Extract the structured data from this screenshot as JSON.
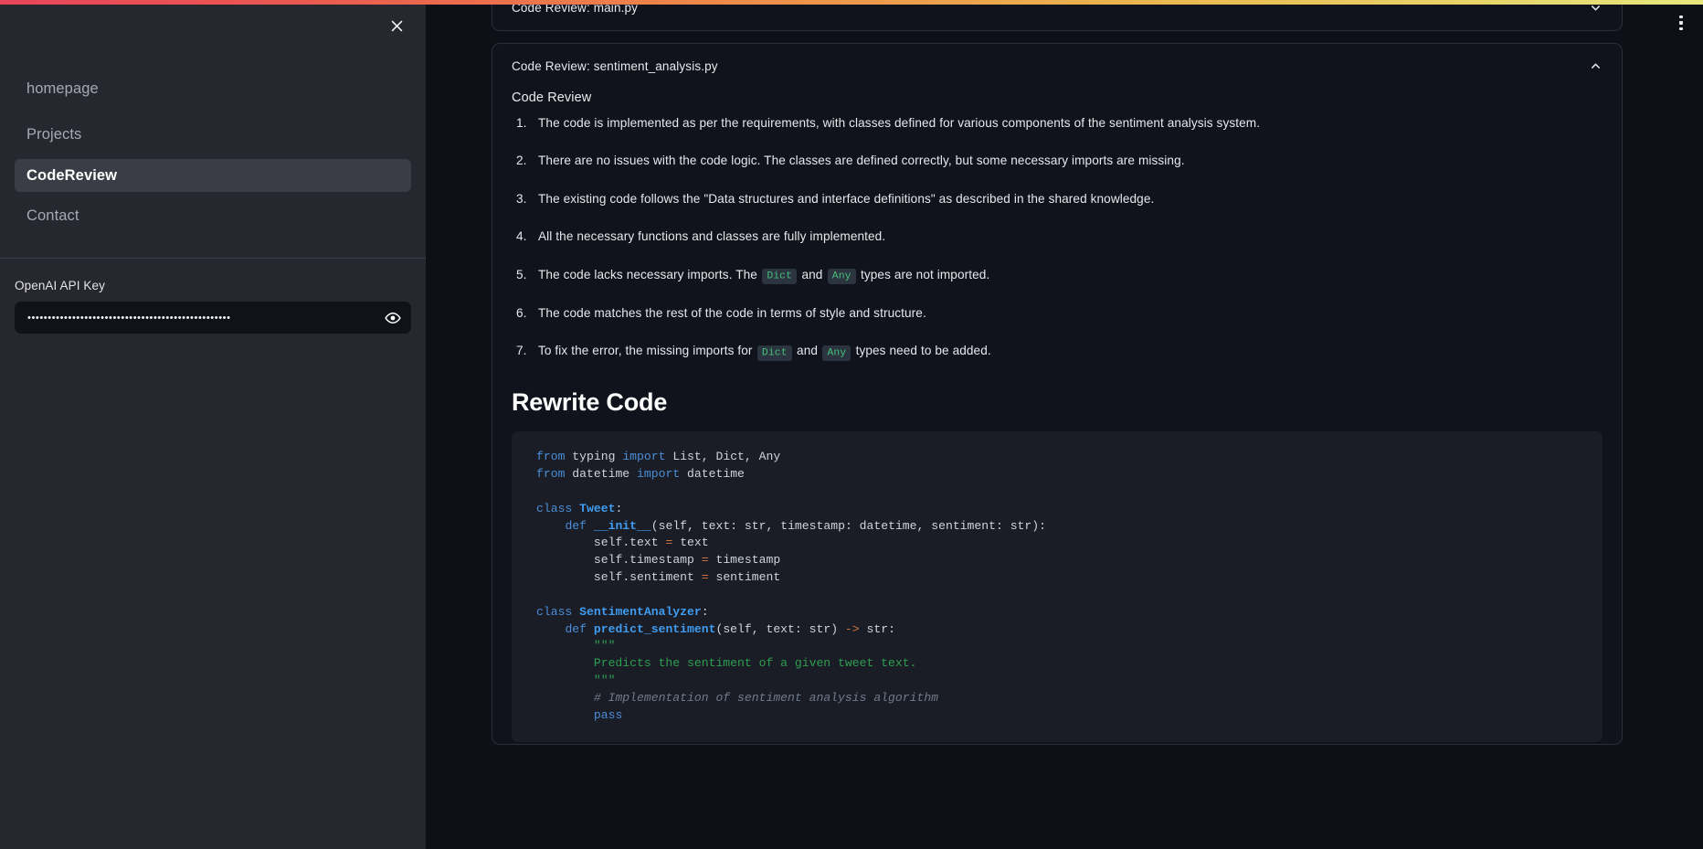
{
  "theme": {
    "gradient_left": "#e8455a",
    "gradient_right": "#e6e87c",
    "sidebar_bg": "#26272f",
    "main_bg": "#0d1017",
    "card_bg": "#10131b",
    "code_bg": "#1a1d26",
    "active_nav_bg": "#3a3c46",
    "inline_code_color": "#45c07a"
  },
  "sidebar": {
    "close_icon": "close-icon",
    "nav": [
      {
        "label": "homepage",
        "active": false
      },
      {
        "label": "Projects",
        "active": false
      },
      {
        "label": "CodeReview",
        "active": true
      },
      {
        "label": "Contact",
        "active": false
      }
    ],
    "api_key": {
      "label": "OpenAI API Key",
      "value": "••••••••••••••••••••••••••••••••••••••••••••••••••",
      "placeholder": "",
      "toggle_icon": "eye-icon"
    }
  },
  "main": {
    "kebab_icon": "more-vertical-icon",
    "cards": [
      {
        "title": "Code Review: main.py",
        "expanded": false,
        "chevron_icon": "chevron-down-icon"
      },
      {
        "title": "Code Review: sentiment_analysis.py",
        "expanded": true,
        "chevron_icon": "chevron-up-icon",
        "section_heading": "Code Review",
        "review_items": [
          "The code is implemented as per the requirements, with classes defined for various components of the sentiment analysis system.",
          "There are no issues with the code logic. The classes are defined correctly, but some necessary imports are missing.",
          "The existing code follows the \"Data structures and interface definitions\" as described in the shared knowledge.",
          "All the necessary functions and classes are fully implemented.",
          "The code lacks necessary imports. The |Dict| and |Any| types are not imported.",
          "The code matches the rest of the code in terms of style and structure.",
          "To fix the error, the missing imports for |Dict| and |Any| types need to be added."
        ],
        "rewrite_heading": "Rewrite Code",
        "code_language": "python",
        "code": "from typing import List, Dict, Any\nfrom datetime import datetime\n\nclass Tweet:\n    def __init__(self, text: str, timestamp: datetime, sentiment: str):\n        self.text = text\n        self.timestamp = timestamp\n        self.sentiment = sentiment\n\nclass SentimentAnalyzer:\n    def predict_sentiment(self, text: str) -> str:\n        \"\"\"\n        Predicts the sentiment of a given tweet text.\n        \"\"\"\n        # Implementation of sentiment analysis algorithm\n        pass"
      }
    ]
  }
}
